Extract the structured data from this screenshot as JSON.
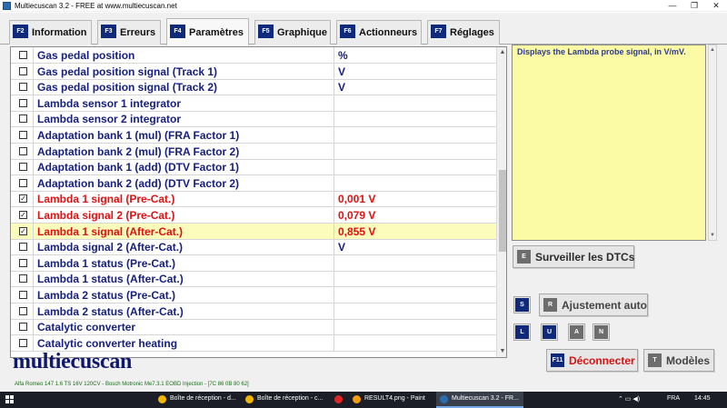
{
  "window": {
    "title": "Multiecuscan 3.2 - FREE at www.multiecuscan.net",
    "minimize": "—",
    "maximize": "❐",
    "close": "✕"
  },
  "tabs": [
    {
      "key": "F2",
      "label": "Information",
      "active": false
    },
    {
      "key": "F3",
      "label": "Erreurs",
      "active": false
    },
    {
      "key": "F4",
      "label": "Paramètres",
      "active": true
    },
    {
      "key": "F5",
      "label": "Graphique",
      "active": false
    },
    {
      "key": "F6",
      "label": "Actionneurs",
      "active": false
    },
    {
      "key": "F7",
      "label": "Réglages",
      "active": false
    }
  ],
  "parameters": [
    {
      "name": "Gas pedal position",
      "value": "%",
      "checked": false,
      "state": "normal"
    },
    {
      "name": "Gas pedal position signal (Track 1)",
      "value": "V",
      "checked": false,
      "state": "normal"
    },
    {
      "name": "Gas pedal position signal (Track 2)",
      "value": "V",
      "checked": false,
      "state": "normal"
    },
    {
      "name": "Lambda sensor 1 integrator",
      "value": "",
      "checked": false,
      "state": "normal"
    },
    {
      "name": "Lambda sensor 2 integrator",
      "value": "",
      "checked": false,
      "state": "normal"
    },
    {
      "name": "Adaptation bank 1 (mul) (FRA Factor 1)",
      "value": "",
      "checked": false,
      "state": "normal"
    },
    {
      "name": "Adaptation bank 2 (mul) (FRA Factor 2)",
      "value": "",
      "checked": false,
      "state": "normal"
    },
    {
      "name": "Adaptation bank 1 (add) (DTV Factor 1)",
      "value": "",
      "checked": false,
      "state": "normal"
    },
    {
      "name": "Adaptation bank 2 (add) (DTV Factor 2)",
      "value": "",
      "checked": false,
      "state": "normal"
    },
    {
      "name": "Lambda 1 signal (Pre-Cat.)",
      "value": "0,001 V",
      "checked": true,
      "state": "red"
    },
    {
      "name": "Lambda signal 2 (Pre-Cat.)",
      "value": "0,079 V",
      "checked": true,
      "state": "red"
    },
    {
      "name": "Lambda 1 signal (After-Cat.)",
      "value": "0,855 V",
      "checked": true,
      "state": "red-highlight"
    },
    {
      "name": "Lambda signal 2 (After-Cat.)",
      "value": "V",
      "checked": false,
      "state": "normal"
    },
    {
      "name": "Lambda 1 status (Pre-Cat.)",
      "value": "",
      "checked": false,
      "state": "normal"
    },
    {
      "name": "Lambda 1 status (After-Cat.)",
      "value": "",
      "checked": false,
      "state": "normal"
    },
    {
      "name": "Lambda 2 status (Pre-Cat.)",
      "value": "",
      "checked": false,
      "state": "normal"
    },
    {
      "name": "Lambda 2 status (After-Cat.)",
      "value": "",
      "checked": false,
      "state": "normal"
    },
    {
      "name": "Catalytic converter",
      "value": "",
      "checked": false,
      "state": "normal"
    },
    {
      "name": "Catalytic converter heating",
      "value": "",
      "checked": false,
      "state": "normal"
    }
  ],
  "info": {
    "text": "Displays the Lambda probe signal, in V/mV."
  },
  "buttons": {
    "dtc": {
      "key": "E",
      "label": "Surveiller les DTCs"
    },
    "auto": {
      "key": "R",
      "label": "Ajustement auto"
    },
    "s_key": "S",
    "letters": [
      "L",
      "U",
      "A",
      "N"
    ],
    "disconnect": {
      "key": "F11",
      "label": "Déconnecter"
    },
    "models": {
      "key": "T",
      "label": "Modèles"
    }
  },
  "logo": "multiecuscan",
  "vehicle_info": "Alfa Romeo 147 1.6 TS 16V 120CV - Bosch Motronic Me7.3.1 EOBD Injection - [7C 86 0B 80 62]",
  "taskbar": {
    "items": [
      {
        "label": "Boîte de réception - d...",
        "color": "#f4b400",
        "active": false
      },
      {
        "label": "Boîte de réception - c...",
        "color": "#f4b400",
        "active": false
      },
      {
        "label": "",
        "color": "#e02424",
        "active": false
      },
      {
        "label": "RESULT4.png - Paint",
        "color": "#f39c12",
        "active": false
      },
      {
        "label": "Multiecuscan 3.2 - FR...",
        "color": "#2b6cb0",
        "active": true
      }
    ],
    "language": "FRA",
    "time": "14:45",
    "tray_icons": "⌃ ▭ ◀)"
  }
}
